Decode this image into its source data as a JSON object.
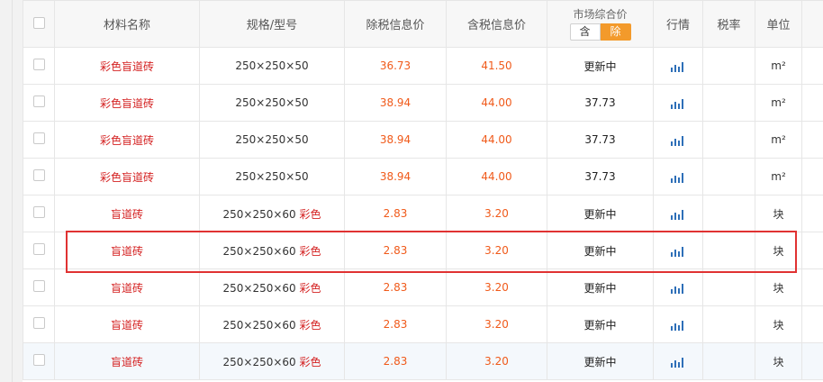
{
  "header": {
    "columns": [
      "材料名称",
      "规格/型号",
      "除税信息价",
      "含税信息价",
      "市场综合价",
      "行情",
      "税率",
      "单位"
    ],
    "market_toggle": {
      "tax_incl_label": "含",
      "tax_excl_label": "除"
    }
  },
  "rows": [
    {
      "name": "彩色盲道砖",
      "spec": "250×250×50",
      "spec_color": "",
      "price_ex": "36.73",
      "price_in": "41.50",
      "market": "更新中",
      "tax": "",
      "unit": "m²"
    },
    {
      "name": "彩色盲道砖",
      "spec": "250×250×50",
      "spec_color": "",
      "price_ex": "38.94",
      "price_in": "44.00",
      "market": "37.73",
      "tax": "",
      "unit": "m²"
    },
    {
      "name": "彩色盲道砖",
      "spec": "250×250×50",
      "spec_color": "",
      "price_ex": "38.94",
      "price_in": "44.00",
      "market": "37.73",
      "tax": "",
      "unit": "m²"
    },
    {
      "name": "彩色盲道砖",
      "spec": "250×250×50",
      "spec_color": "",
      "price_ex": "38.94",
      "price_in": "44.00",
      "market": "37.73",
      "tax": "",
      "unit": "m²"
    },
    {
      "name": "盲道砖",
      "spec": "250×250×60",
      "spec_color": "彩色",
      "price_ex": "2.83",
      "price_in": "3.20",
      "market": "更新中",
      "tax": "",
      "unit": "块"
    },
    {
      "name": "盲道砖",
      "spec": "250×250×60",
      "spec_color": "彩色",
      "price_ex": "2.83",
      "price_in": "3.20",
      "market": "更新中",
      "tax": "",
      "unit": "块"
    },
    {
      "name": "盲道砖",
      "spec": "250×250×60",
      "spec_color": "彩色",
      "price_ex": "2.83",
      "price_in": "3.20",
      "market": "更新中",
      "tax": "",
      "unit": "块"
    },
    {
      "name": "盲道砖",
      "spec": "250×250×60",
      "spec_color": "彩色",
      "price_ex": "2.83",
      "price_in": "3.20",
      "market": "更新中",
      "tax": "",
      "unit": "块"
    },
    {
      "name": "盲道砖",
      "spec": "250×250×60",
      "spec_color": "彩色",
      "price_ex": "2.83",
      "price_in": "3.20",
      "market": "更新中",
      "tax": "",
      "unit": "块"
    }
  ],
  "icons": {
    "row_trend": "bar-chart-icon"
  },
  "colors": {
    "accent_orange": "#f39a2b",
    "price_text": "#f05a1a",
    "name_text": "#d42222",
    "trend_blue": "#2e6fb8",
    "highlight": "#e03232"
  }
}
